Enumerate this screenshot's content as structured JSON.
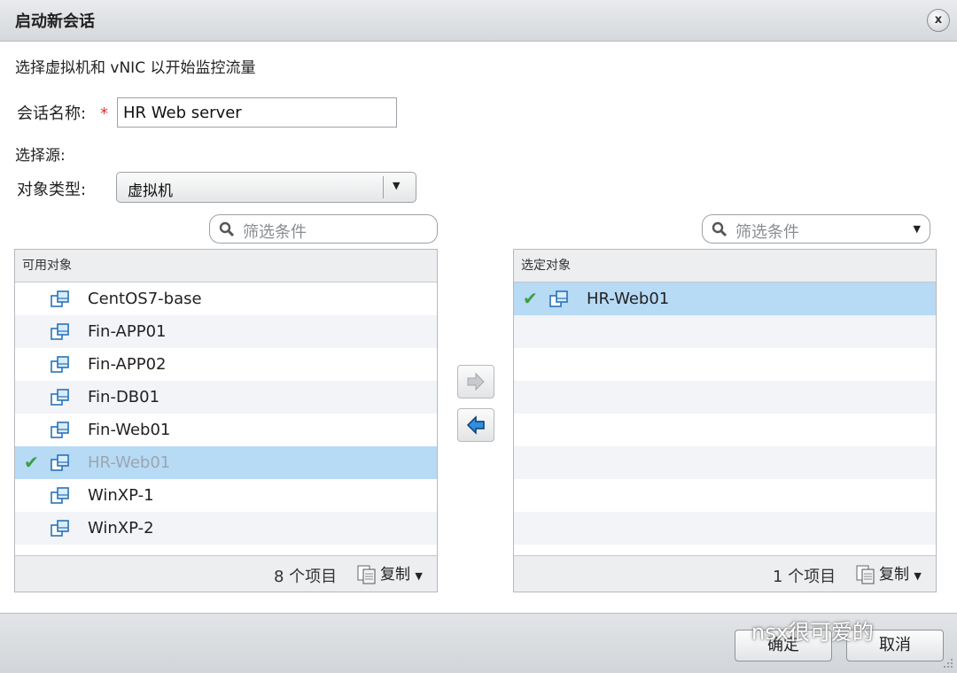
{
  "dialog": {
    "title": "启动新会话",
    "close_glyph": "x"
  },
  "instruction": "选择虚拟机和 vNIC 以开始监控流量",
  "session_name": {
    "label": "会话名称:",
    "required_mark": "*",
    "value": "HR Web server"
  },
  "source": {
    "label": "选择源:"
  },
  "object_type": {
    "label": "对象类型:",
    "selected": "虚拟机"
  },
  "available": {
    "filter_placeholder": "筛选条件",
    "header": "可用对象",
    "items": [
      {
        "label": "CentOS7-base",
        "selected": false
      },
      {
        "label": "Fin-APP01",
        "selected": false
      },
      {
        "label": "Fin-APP02",
        "selected": false
      },
      {
        "label": "Fin-DB01",
        "selected": false
      },
      {
        "label": "Fin-Web01",
        "selected": false
      },
      {
        "label": "HR-Web01",
        "selected": true
      },
      {
        "label": "WinXP-1",
        "selected": false
      },
      {
        "label": "WinXP-2",
        "selected": false
      }
    ],
    "count_text": "8 个项目",
    "copy_label": "复制"
  },
  "selected_objects": {
    "filter_placeholder": "筛选条件",
    "header": "选定对象",
    "items": [
      {
        "label": "HR-Web01",
        "selected": true
      }
    ],
    "count_text": "1 个项目",
    "copy_label": "复制"
  },
  "buttons": {
    "ok": "确定",
    "cancel": "取消"
  },
  "watermark": "nsx很可爱的",
  "colors": {
    "selected_row": "#b7daf5",
    "alt_row": "#f2f4f8",
    "check": "#3aa043",
    "required": "#e0322d",
    "vm_icon": "#2a72b8"
  },
  "icons": {
    "search": "search-icon",
    "vm": "vm-icon",
    "check": "check-icon",
    "copy": "copy-icon",
    "move_right": "arrow-right-icon",
    "move_left": "arrow-left-icon"
  }
}
